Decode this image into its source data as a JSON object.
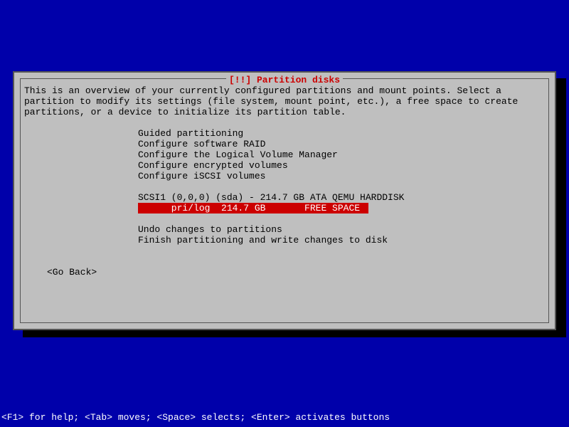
{
  "dialog": {
    "title": "[!!] Partition disks",
    "description": "This is an overview of your currently configured partitions and mount points. Select a partition to modify its settings (file system, mount point, etc.), a free space to create partitions, or a device to initialize its partition table.",
    "menu_items": [
      "Guided partitioning",
      "Configure software RAID",
      "Configure the Logical Volume Manager",
      "Configure encrypted volumes",
      "Configure iSCSI volumes"
    ],
    "disk_header": "SCSI1 (0,0,0) (sda) - 214.7 GB ATA QEMU HARDDISK",
    "partition_selected": "      pri/log  214.7 GB       FREE SPACE",
    "post_items": [
      "Undo changes to partitions",
      "Finish partitioning and write changes to disk"
    ],
    "go_back": "<Go Back>"
  },
  "footer": "<F1> for help; <Tab> moves; <Space> selects; <Enter> activates buttons"
}
